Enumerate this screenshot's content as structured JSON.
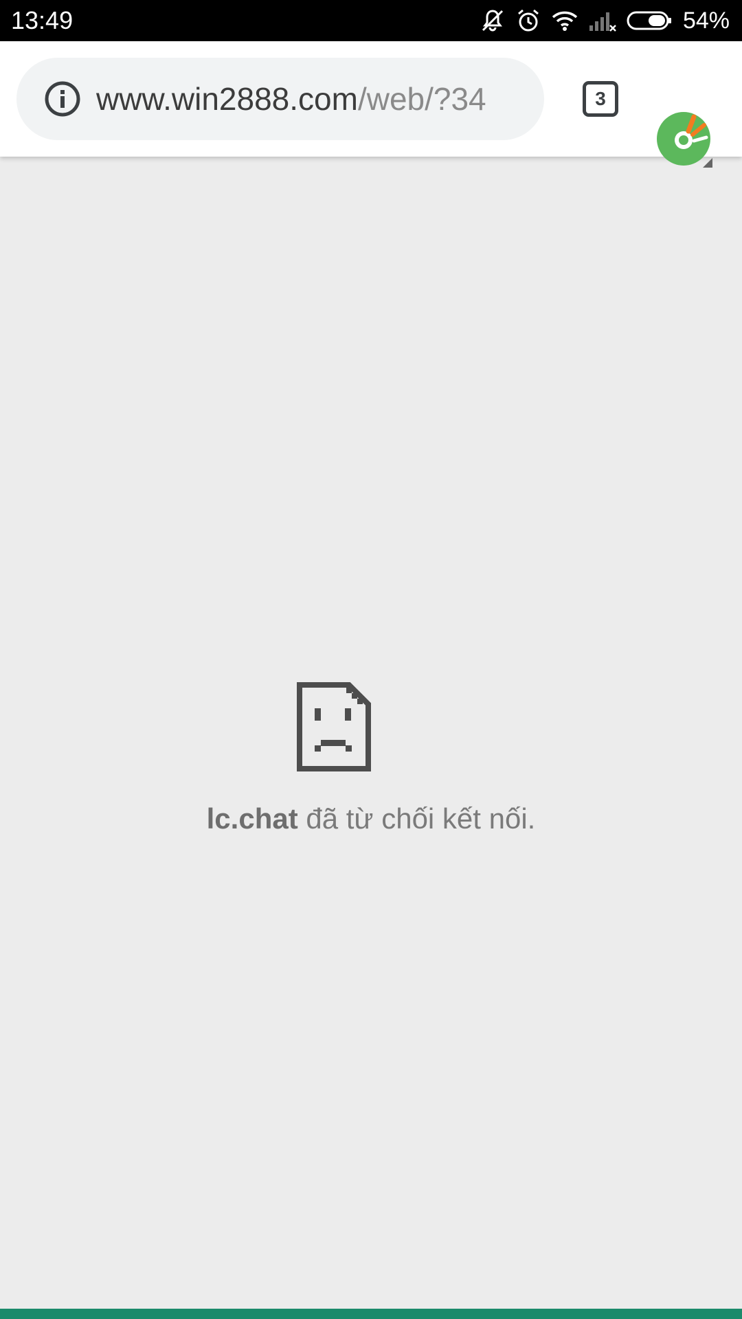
{
  "status_bar": {
    "time": "13:49",
    "battery_percent": "54%",
    "icons": [
      "notifications-off-icon",
      "alarm-icon",
      "wifi-icon",
      "signal-no-service-icon",
      "battery-icon"
    ]
  },
  "toolbar": {
    "url_domain": "www.win2888.com",
    "url_path": "/web/?34",
    "tab_count": "3",
    "icons": [
      "info-icon",
      "tab-switcher-icon",
      "coc-coc-menu-logo"
    ]
  },
  "error_page": {
    "host": "lc.chat",
    "message": " đã từ chối kết nối.",
    "icon": "sad-page-icon"
  },
  "colors": {
    "status_bar": "#000000",
    "page_background": "#ececec",
    "omnibox_background": "#f1f3f4",
    "bottom_accent": "#1b8a6b",
    "logo_green": "#5cb85c",
    "logo_orange": "#f47b20"
  }
}
